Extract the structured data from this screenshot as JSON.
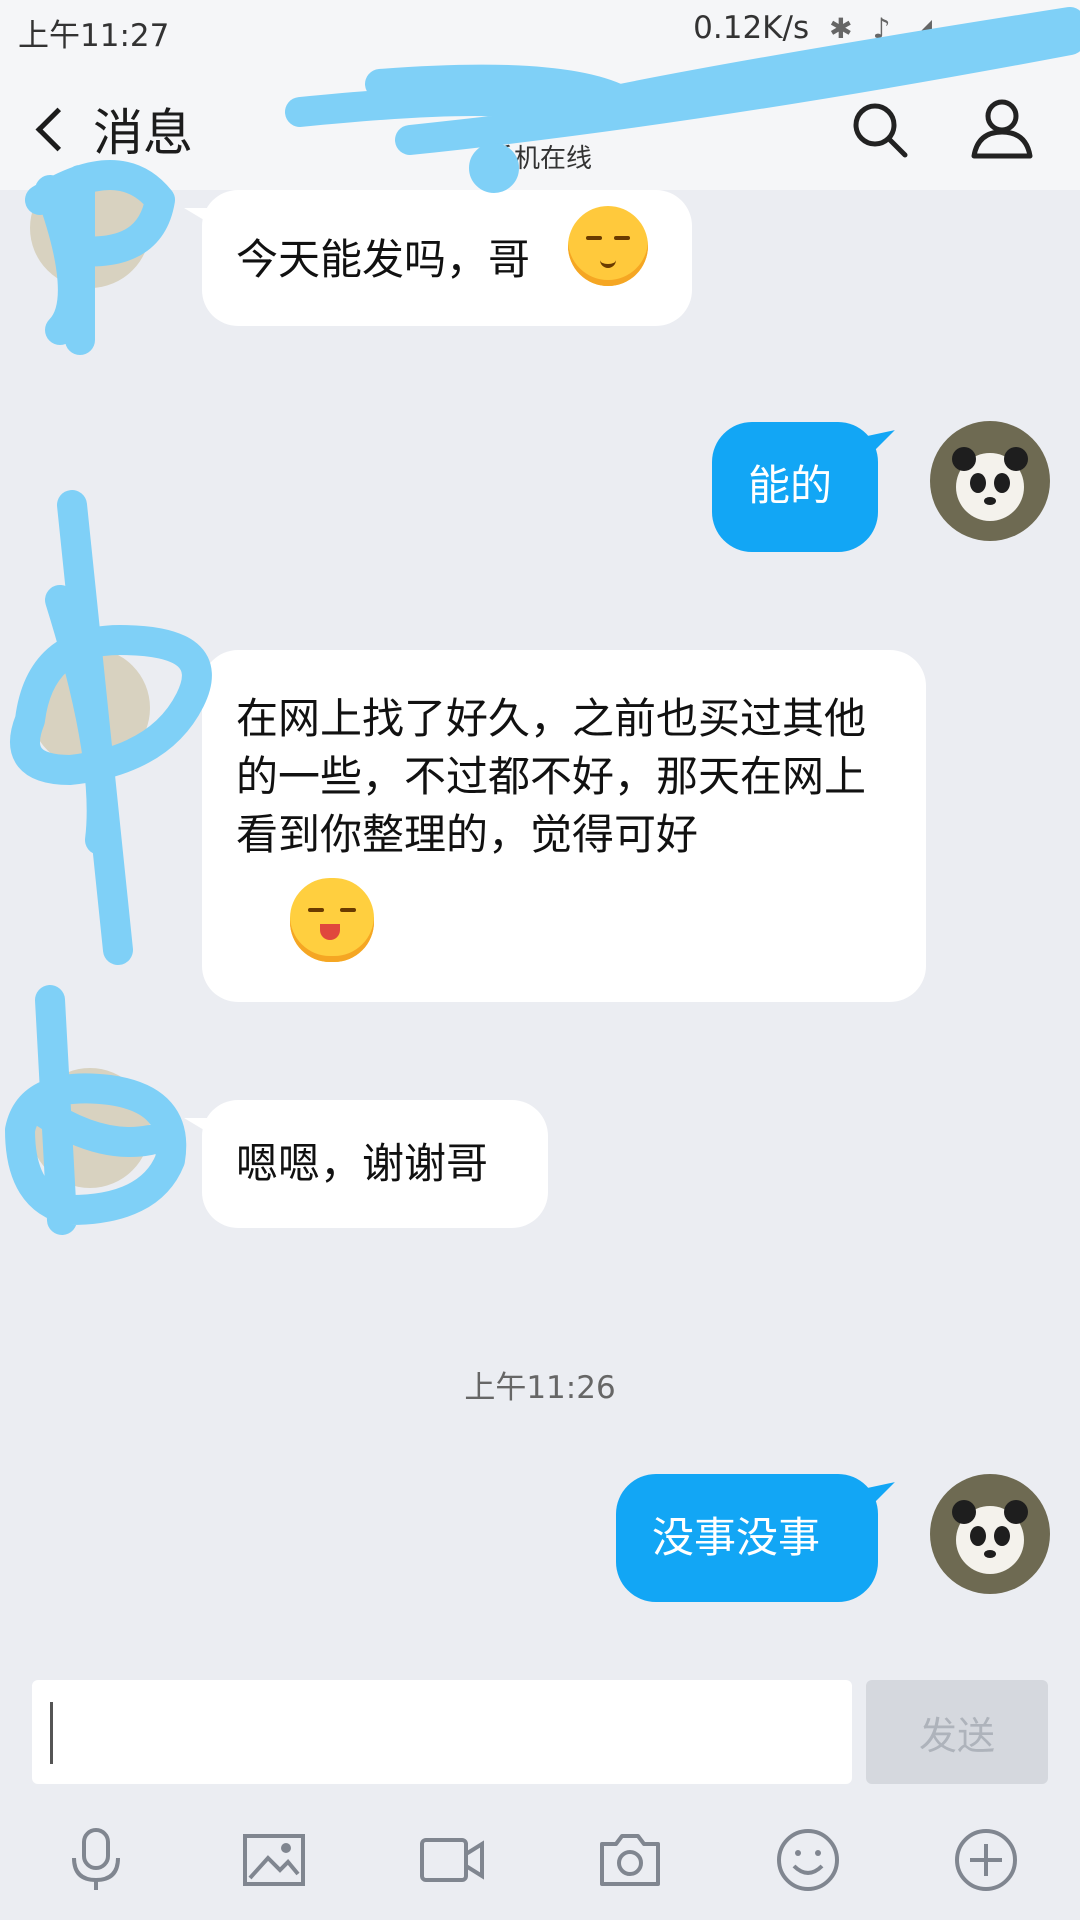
{
  "status_bar": {
    "time": "上午11:27",
    "net_speed": "0.12K/s",
    "bluetooth_icon": "bluetooth-icon",
    "mute_icon": "vibrate-off-icon",
    "signal_icon": "signal-icon"
  },
  "nav": {
    "back_label": "消息",
    "title": "",
    "subtitle": "手机在线"
  },
  "messages": [
    {
      "side": "other",
      "text": "今天能发吗，哥",
      "emoji": "blush-face-emoji"
    },
    {
      "side": "me",
      "text": "能的"
    },
    {
      "side": "other",
      "text": "在网上找了好久，之前也买过其他的一些，不过都不好，那天在网上看到你整理的，觉得可好",
      "emoji": "laughing-hands-emoji"
    },
    {
      "side": "other",
      "text": "嗯嗯，谢谢哥"
    },
    {
      "side": "me",
      "text": "没事没事"
    }
  ],
  "timestamp": "上午11:26",
  "composer": {
    "input_value": "",
    "send_label": "发送"
  },
  "toolbar_icons": [
    "microphone-icon",
    "image-icon",
    "video-icon",
    "camera-icon",
    "emoji-icon",
    "plus-icon"
  ],
  "colors": {
    "accent": "#12a6f5",
    "background": "#ebedf2",
    "scribble": "#7fd0f7"
  }
}
